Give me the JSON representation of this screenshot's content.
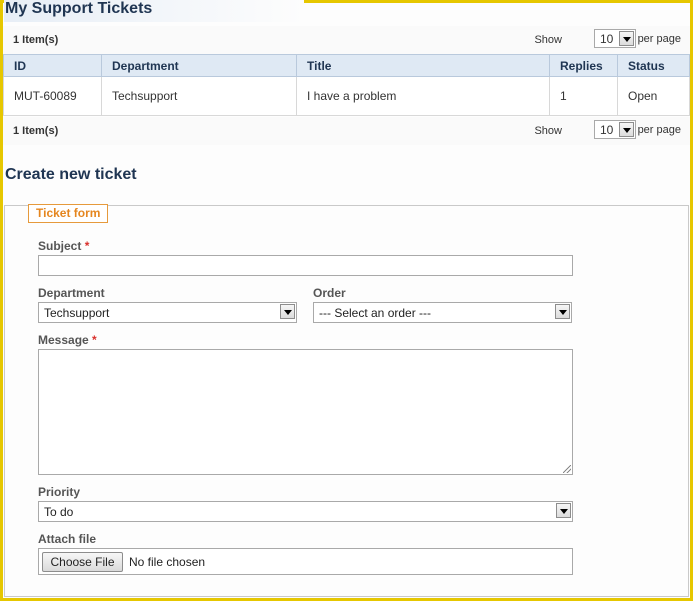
{
  "page_title": "My Support Tickets",
  "pager": {
    "count": "1 Item(s)",
    "show": "Show",
    "value": "10",
    "per_page": "per page"
  },
  "table": {
    "headers": [
      "ID",
      "Department",
      "Title",
      "Replies",
      "Status"
    ],
    "rows": [
      [
        "MUT-60089",
        "Techsupport",
        "I have a problem",
        "1",
        "Open"
      ]
    ]
  },
  "create_title": "Create new ticket",
  "form": {
    "legend": "Ticket form",
    "subject_label": "Subject",
    "required_mark": "*",
    "subject_value": "",
    "department_label": "Department",
    "department_value": "Techsupport",
    "order_label": "Order",
    "order_value": "--- Select an order ---",
    "message_label": "Message",
    "message_value": "",
    "priority_label": "Priority",
    "priority_value": "To do",
    "attach_label": "Attach file",
    "choose_file": "Choose File",
    "file_status": "No file chosen"
  },
  "colors": {
    "frame_border": "#e6c700",
    "heading": "#1f3552",
    "legend": "#e5861f",
    "required": "#d9302c",
    "table_header_bg": "#dfe9f4"
  },
  "icons": {
    "select_arrow": "chevron-down-icon",
    "textarea_resize": "resize-grip-icon"
  }
}
